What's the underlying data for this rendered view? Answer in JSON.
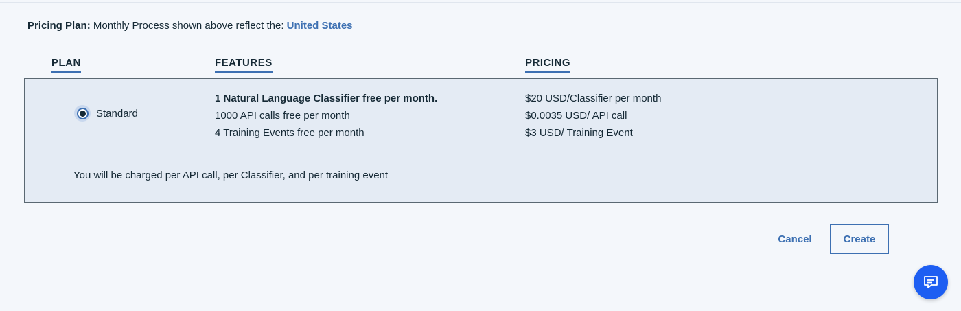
{
  "pricing_plan": {
    "label": "Pricing Plan:",
    "text": "Monthly Process shown above reflect the:",
    "country": "United States"
  },
  "table": {
    "headers": {
      "plan": "PLAN",
      "features": "FEATURES",
      "pricing": "PRICING"
    },
    "plan": {
      "name": "Standard",
      "selected": true,
      "features": [
        "1 Natural Language Classifier free per month.",
        "1000 API calls free per month",
        "4 Training Events free per month"
      ],
      "pricing": [
        "$20 USD/Classifier per month",
        "$0.0035 USD/ API call",
        "$3 USD/ Training Event"
      ],
      "charge_note": "You will be charged per API call, per Classifier, and per training event"
    }
  },
  "actions": {
    "cancel_label": "Cancel",
    "create_label": "Create"
  },
  "chat": {
    "icon": "chat-icon"
  },
  "colors": {
    "accent": "#3d70b2",
    "chat_bg": "#1d5ef2",
    "selected_row_bg": "#e4ebf4"
  }
}
